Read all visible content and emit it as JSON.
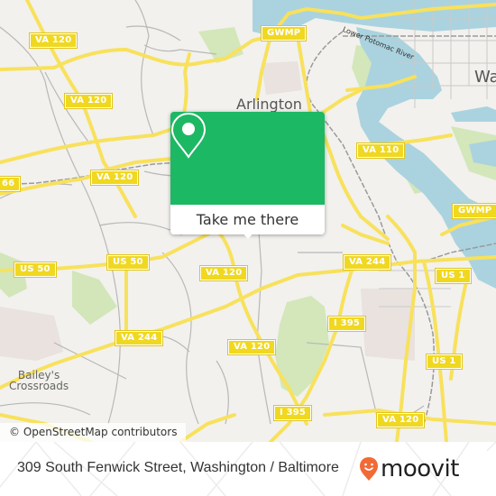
{
  "map": {
    "colors": {
      "land": "#f2f1ed",
      "water": "#aad3df",
      "park": "#cfe5b4",
      "road_major": "#f8e15c",
      "road_minor": "#b8b8b8",
      "rail": "#999999",
      "shield_bg": "#f0d821"
    },
    "place_labels": {
      "arlington": "Arlington",
      "washington_partial": "Wa",
      "baileys_line1": "Bailey's",
      "baileys_line2": "Crossroads"
    },
    "water_labels": {
      "potomac": "Lower Potomac River"
    },
    "road_shields": [
      {
        "id": "va120-a",
        "label": "VA 120"
      },
      {
        "id": "va120-b",
        "label": "VA 120"
      },
      {
        "id": "va120-c",
        "label": "VA 120"
      },
      {
        "id": "i66",
        "label": "66"
      },
      {
        "id": "gwmp-a",
        "label": "GWMP"
      },
      {
        "id": "va110",
        "label": "VA 110"
      },
      {
        "id": "gwmp-b",
        "label": "GWMP"
      },
      {
        "id": "us50-a",
        "label": "US 50"
      },
      {
        "id": "us50-b",
        "label": "US 50"
      },
      {
        "id": "va120-d",
        "label": "VA 120"
      },
      {
        "id": "va244-a",
        "label": "VA 244"
      },
      {
        "id": "va244-b",
        "label": "VA 244"
      },
      {
        "id": "us1-a",
        "label": "US 1"
      },
      {
        "id": "i395-a",
        "label": "I 395"
      },
      {
        "id": "va120-e",
        "label": "VA 120"
      },
      {
        "id": "us1-b",
        "label": "US 1"
      },
      {
        "id": "i395-b",
        "label": "I 395"
      },
      {
        "id": "va120-f",
        "label": "VA 120"
      }
    ],
    "attribution": "© OpenStreetMap contributors"
  },
  "popup": {
    "icon": "map-pin-icon",
    "button_label": "Take me there",
    "accent_color": "#1db863"
  },
  "footer": {
    "address": "309 South Fenwick Street, Washington / Baltimore",
    "brand": "moovit",
    "brand_color": "#f26a36"
  }
}
